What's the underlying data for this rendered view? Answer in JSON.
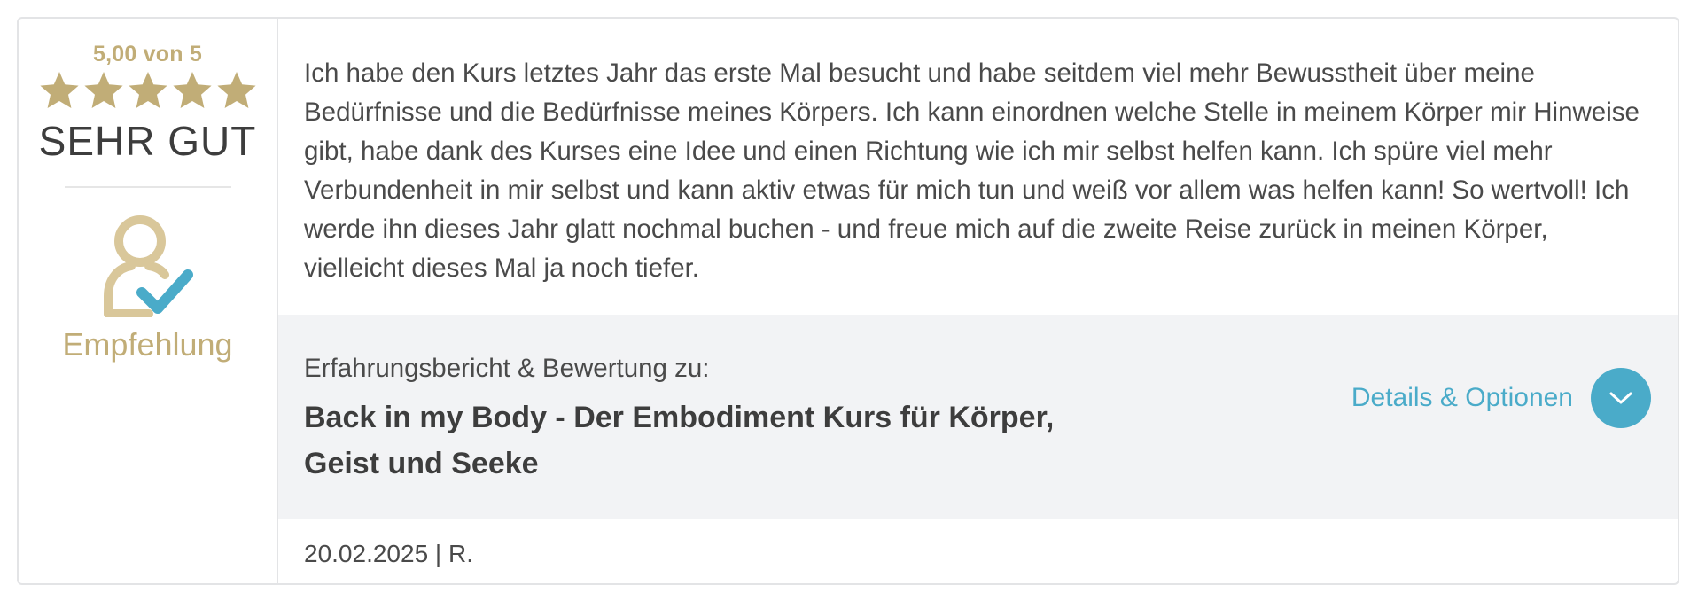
{
  "rating": {
    "score_text": "5,00 von 5",
    "stars": 5,
    "max_stars": 5,
    "verdict": "SEHR GUT",
    "recommendation_label": "Empfehlung"
  },
  "review": {
    "text": "Ich habe den Kurs letztes Jahr das erste Mal besucht und habe seitdem viel mehr Bewusstheit über meine Bedürfnisse und die Bedürfnisse meines Körpers. Ich kann einordnen welche Stelle in meinem Körper mir Hinweise gibt, habe dank des Kurses eine Idee und einen Richtung wie ich mir selbst helfen kann. Ich spüre viel mehr Verbundenheit in mir selbst und kann aktiv etwas für mich tun und weiß vor allem was helfen kann! So wertvoll! Ich werde ihn dieses Jahr glatt nochmal buchen - und freue mich auf die zweite Reise zurück in meinen Körper, vielleicht dieses Mal ja noch tiefer."
  },
  "product": {
    "prefix": "Erfahrungsbericht & Bewertung zu:",
    "title": "Back in my Body - Der Embodiment Kurs für Körper, Geist und Seeke"
  },
  "details": {
    "label": "Details & Optionen"
  },
  "meta": {
    "date_author": "20.02.2025 | R."
  },
  "colors": {
    "gold": "#c1ad77",
    "accent_blue": "#4aabc9",
    "panel_gray": "#f2f3f5",
    "border": "#e3e4e6"
  },
  "icons": [
    "star-icon",
    "user-check-icon",
    "chevron-down-icon"
  ]
}
